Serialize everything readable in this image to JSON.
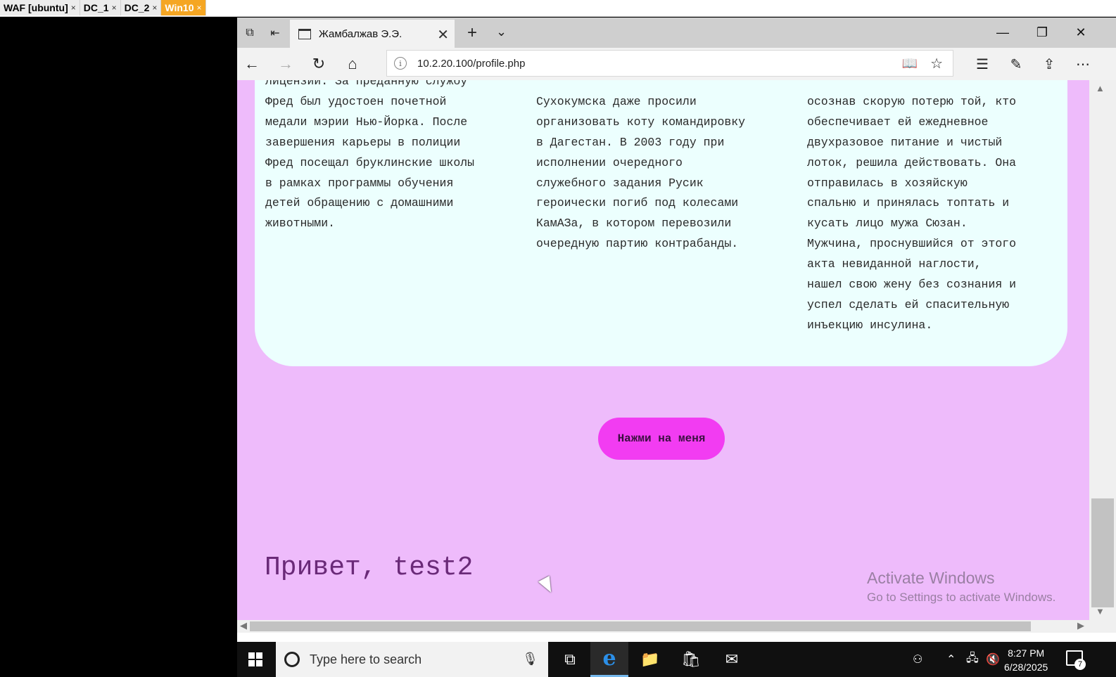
{
  "host_tabs": [
    {
      "label": "WAF [ubuntu]",
      "close": "×"
    },
    {
      "label": "DC_1",
      "close": "×"
    },
    {
      "label": "DC_2",
      "close": "×"
    },
    {
      "label": "Win10",
      "close": "×"
    }
  ],
  "browser": {
    "tab_title": "Жамбалжав Э.Э.",
    "url": "10.2.20.100/profile.php"
  },
  "page": {
    "col1": "лицензии. За преданную службу\nФред был удостоен почетной\nмедали мэрии Нью-Йорка. После\nзавершения карьеры в полиции\nФред посещал бруклинские школы\nв рамках программы обучения\nдетей обращению с домашними\nживотными.",
    "col2": "\nСухокумска даже просили\nорганизовать коту командировку\nв Дагестан. В 2003 году при\nисполнении очередного\nслужебного задания Русик\nгероически погиб под колесами\nКамАЗа, в котором перевозили\nочередную партию контрабанды.",
    "col3": "\nосознав скорую потерю той, кто\nобеспечивает ей ежедневное\nдвухразовое питание и чистый\nлоток, решила действовать. Она\nотправилась в хозяйскую\nспальню и принялась топтать и\nкусать лицо мужа Сюзан.\nМужчина, проснувшийся от этого\nакта невиданной наглости,\nнашел свою жену без сознания и\nуспел сделать ей спасительную\nинъекцию инсулина.",
    "button_label": "Нажми на меня",
    "greeting": "Привет, test2"
  },
  "watermark": {
    "line1": "Activate Windows",
    "line2": "Go to Settings to activate Windows."
  },
  "taskbar": {
    "search_placeholder": "Type here to search",
    "time": "8:27 PM",
    "date": "6/28/2025",
    "notification_count": "7"
  },
  "colors": {
    "page_background": "#eebbfb",
    "card_background": "#ecfffe",
    "button_background": "#f23cf2",
    "greeting_text": "#6a2a78",
    "host_active_tab": "#f5a623"
  }
}
